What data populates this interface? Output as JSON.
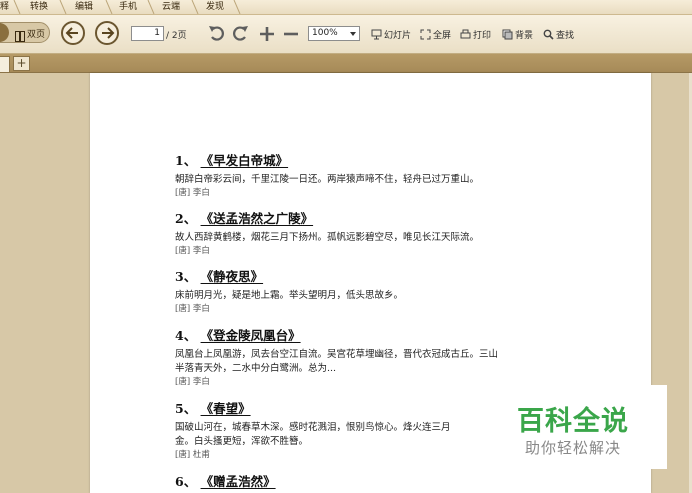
{
  "menu": {
    "tabs": [
      "释",
      "转换",
      "编辑",
      "手机",
      "云端",
      "发现"
    ]
  },
  "toolbar": {
    "view_label": "双页",
    "page_current": "1",
    "page_total": "/ 2页",
    "zoom": "100%",
    "slideshow": "幻灯片",
    "fullscreen": "全屏",
    "print": "打印",
    "background": "背景",
    "find": "查找"
  },
  "tabstrip": {
    "add_label": "+"
  },
  "document": {
    "poems": [
      {
        "num": "1、",
        "title": "《早发白帝城》",
        "lines": [
          "朝辞白帝彩云间，千里江陵一日还。两岸猿声啼不住，轻舟已过万重山。"
        ],
        "author": "[唐] 李白"
      },
      {
        "num": "2、",
        "title": "《送孟浩然之广陵》",
        "lines": [
          "故人西辞黄鹤楼，烟花三月下扬州。孤帆远影碧空尽，唯见长江天际流。"
        ],
        "author": "[唐] 李白"
      },
      {
        "num": "3、",
        "title": "《静夜思》",
        "lines": [
          "床前明月光，疑是地上霜。举头望明月，低头思故乡。"
        ],
        "author": "[唐] 李白"
      },
      {
        "num": "4、",
        "title": "《登金陵凤凰台》",
        "lines": [
          "凤凰台上凤凰游，凤去台空江自流。吴宫花草埋幽径，晋代衣冠成古丘。三山",
          "半落青天外，二水中分白鹭洲。总为..."
        ],
        "author": "[唐] 李白"
      },
      {
        "num": "5、",
        "title": "《春望》",
        "lines": [
          "国破山河在，城春草木深。感时花溅泪，恨别鸟惊心。烽火连三月",
          "金。白头搔更短，浑欲不胜簪。"
        ],
        "author": "[唐] 杜甫"
      },
      {
        "num": "6、",
        "title": "《赠孟浩然》",
        "lines": [],
        "author": ""
      }
    ]
  },
  "watermark": {
    "main": "百科全说",
    "sub": "助你轻松解决",
    "color": "#3aa64a"
  }
}
